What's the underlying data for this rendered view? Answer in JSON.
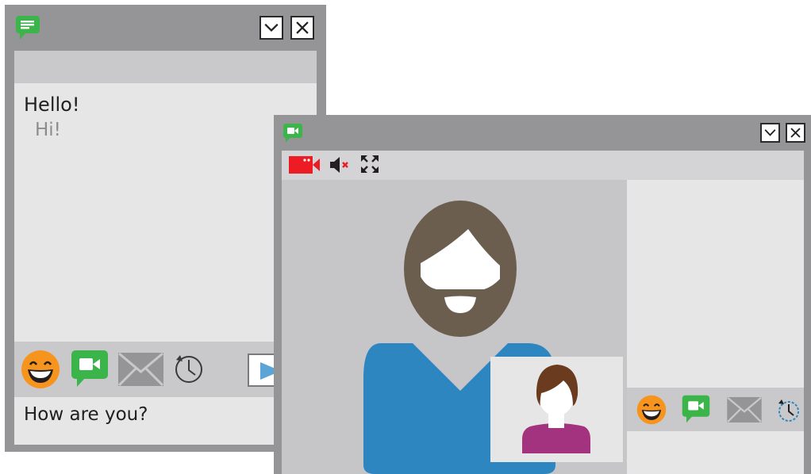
{
  "chat_window": {
    "messages": [
      {
        "text": "Hello!",
        "from": "self"
      },
      {
        "text": "Hi!",
        "from": "other"
      }
    ],
    "input_value": "How are you?",
    "toolbar_icons": [
      "emoji-icon",
      "video-call-icon",
      "email-icon",
      "history-icon",
      "send-icon"
    ]
  },
  "video_window": {
    "controls": [
      "camera-off-icon",
      "speaker-muted-icon",
      "fullscreen-icon"
    ],
    "toolbar_icons": [
      "emoji-icon",
      "video-call-icon",
      "email-icon",
      "history-icon"
    ]
  },
  "colors": {
    "frame": "#959598",
    "panel": "#e6e6e7",
    "toolbar": "#c9c9cb",
    "accent_green": "#3bb54a",
    "emoji_orange": "#f7941d",
    "alert_red": "#ed1c24",
    "avatar_brown": "#6b5e4f",
    "shirt_blue": "#2e86c1",
    "shirt_magenta": "#a3337e"
  }
}
